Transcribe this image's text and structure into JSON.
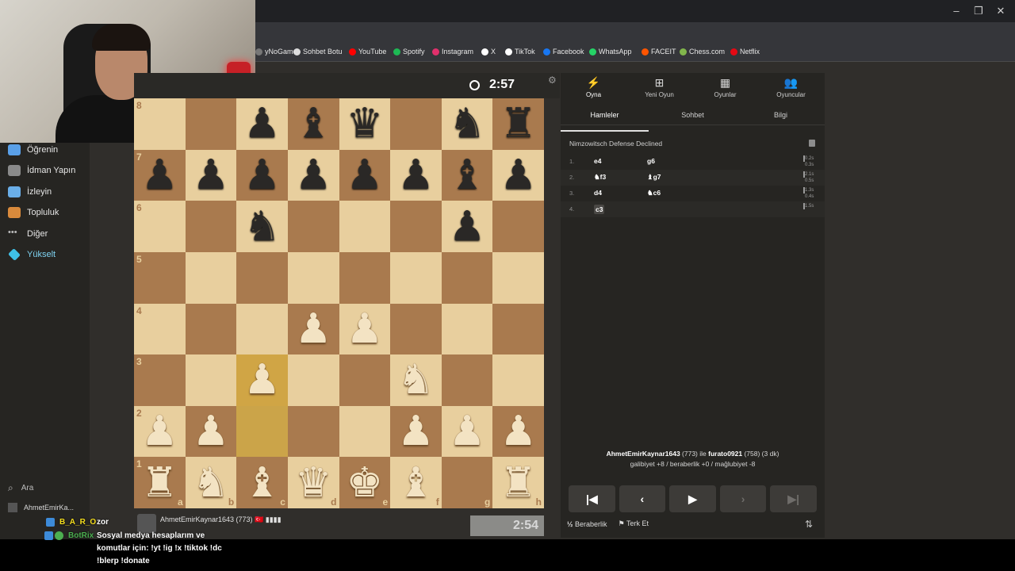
{
  "browser": {
    "bookmarks": [
      {
        "label": "yNoGame",
        "color": "#777777"
      },
      {
        "label": "Sohbet Botu",
        "color": "#dddddd"
      },
      {
        "label": "YouTube",
        "color": "#ff0000"
      },
      {
        "label": "Spotify",
        "color": "#1db954"
      },
      {
        "label": "Instagram",
        "color": "#e1306c"
      },
      {
        "label": "X",
        "color": "#ffffff"
      },
      {
        "label": "TikTok",
        "color": "#ffffff"
      },
      {
        "label": "Facebook",
        "color": "#1877f2"
      },
      {
        "label": "WhatsApp",
        "color": "#25d366"
      },
      {
        "label": "FACEIT",
        "color": "#ff5500"
      },
      {
        "label": "Chess.com",
        "color": "#81b64c"
      },
      {
        "label": "Netflix",
        "color": "#e50914"
      }
    ],
    "window_controls": [
      "–",
      "❐",
      "✕"
    ]
  },
  "nav": {
    "items": [
      {
        "label": "Öğrenin",
        "icon": "graduation-cap-icon",
        "color": "#5aa0e8"
      },
      {
        "label": "İdman Yapın",
        "icon": "puzzle-icon",
        "color": "#8a8a8a"
      },
      {
        "label": "İzleyin",
        "icon": "binoculars-icon",
        "color": "#6aaee8"
      },
      {
        "label": "Topluluk",
        "icon": "community-icon",
        "color": "#d98a3c"
      },
      {
        "label": "Diğer",
        "icon": "more-dots-icon",
        "color": "#bbbbbb"
      },
      {
        "label": "Yükselt",
        "icon": "diamond-icon",
        "color": "#3fc1e8"
      }
    ],
    "search_label": "Ara",
    "user_label": "AhmetEmirKa..."
  },
  "board": {
    "top_clock": "2:57",
    "bottom_clock": "2:54",
    "ranks": [
      "8",
      "7",
      "6",
      "5",
      "4",
      "3",
      "2",
      "1"
    ],
    "files": [
      "a",
      "b",
      "c",
      "d",
      "e",
      "f",
      "g",
      "h"
    ],
    "position": [
      [
        "",
        "",
        "b_p",
        "b_b",
        "b_q",
        "",
        "b_n",
        "b_r"
      ],
      [
        "b_p",
        "b_p",
        "b_p",
        "b_p",
        "b_p",
        "b_p",
        "b_b",
        "b_p"
      ],
      [
        "",
        "",
        "b_n",
        "",
        "",
        "",
        "b_p",
        ""
      ],
      [
        "",
        "",
        "",
        "",
        "",
        "",
        "",
        ""
      ],
      [
        "",
        "",
        "",
        "w_p",
        "w_p",
        "",
        "",
        ""
      ],
      [
        "",
        "",
        "w_p",
        "",
        "",
        "w_n",
        "",
        ""
      ],
      [
        "w_p",
        "w_p",
        "",
        "",
        "",
        "w_p",
        "w_p",
        "w_p"
      ],
      [
        "w_r",
        "w_n",
        "w_b",
        "w_q",
        "w_k",
        "w_b",
        "",
        "w_r"
      ]
    ],
    "highlights": [
      "c3",
      "c2"
    ],
    "bottom_player": "AhmetEmirKaynar1643 (773) 🇹🇷 ▮▮▮▮"
  },
  "panel": {
    "tabs": [
      {
        "label": "Oyna",
        "icon": "lightning-icon"
      },
      {
        "label": "Yeni Oyun",
        "icon": "plus-square-icon"
      },
      {
        "label": "Oyunlar",
        "icon": "board-icon"
      },
      {
        "label": "Oyuncular",
        "icon": "players-icon"
      }
    ],
    "subtabs": [
      "Hamleler",
      "Sohbet",
      "Bilgi"
    ],
    "opening": "Nimzowitsch Defense Declined",
    "moves": [
      {
        "num": "1.",
        "white": "e4",
        "black": "g6",
        "t1": "0.2s",
        "t2": "0.3s"
      },
      {
        "num": "2.",
        "white": "♞f3",
        "black": "♝g7",
        "t1": "2.1s",
        "t2": "0.5s"
      },
      {
        "num": "3.",
        "white": "d4",
        "black": "♞c6",
        "t1": "1.3s",
        "t2": "0.4s"
      },
      {
        "num": "4.",
        "white": "c3",
        "black": "",
        "t1": "1.5s",
        "t2": ""
      }
    ],
    "result_line1_p1": "AhmetEmirKaynar1643",
    "result_line1_mid1": " (773) ile ",
    "result_line1_p2": "furato0921",
    "result_line1_mid2": " (758) (3 dk)",
    "result_line2": "galibiyet +8 / beraberlik +0 / mağlubiyet -8",
    "nav_buttons": [
      "|◀",
      "‹",
      "▶",
      "›",
      "▶|"
    ],
    "draw_label": "Beraberlik",
    "draw_icon": "½",
    "resign_label": "Terk Et",
    "flip_icon": "⇅"
  },
  "chat": {
    "line1_name": "B_A_R_O",
    "line1_text": "zor",
    "line2_name": "BotRix",
    "line2_text": "Sosyal medya hesaplarım ve",
    "line3_text": "komutlar için: !yt !ig !x !tiktok !dc",
    "line4_text": "!blerp !donate"
  }
}
